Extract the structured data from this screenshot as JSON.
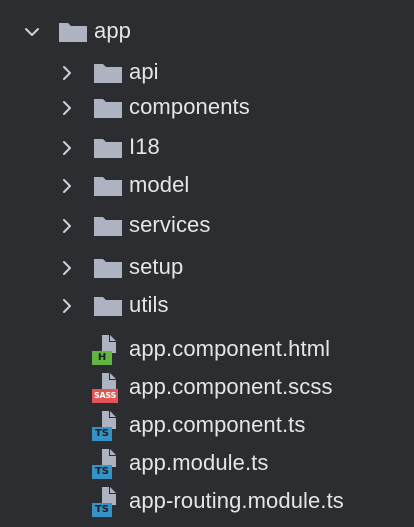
{
  "colors": {
    "background": "#2b2d30",
    "text": "#e3e5e8",
    "folder": "#aeb3c2",
    "chevron": "#ced0d6",
    "html_badge": "#62b543",
    "sass_badge": "#e05555",
    "ts_badge": "#3592c4"
  },
  "root": {
    "label": "app",
    "expanded": true,
    "icon": "folder-icon",
    "chevron": "chevron-down-icon"
  },
  "folders": [
    {
      "label": "api",
      "expanded": false,
      "icon": "folder-icon",
      "chevron": "chevron-right-icon"
    },
    {
      "label": "components",
      "expanded": false,
      "icon": "folder-icon",
      "chevron": "chevron-right-icon"
    },
    {
      "label": "I18",
      "expanded": false,
      "icon": "folder-icon",
      "chevron": "chevron-right-icon"
    },
    {
      "label": "model",
      "expanded": false,
      "icon": "folder-icon",
      "chevron": "chevron-right-icon"
    },
    {
      "label": "services",
      "expanded": false,
      "icon": "folder-icon",
      "chevron": "chevron-right-icon"
    },
    {
      "label": "setup",
      "expanded": false,
      "icon": "folder-icon",
      "chevron": "chevron-right-icon"
    },
    {
      "label": "utils",
      "expanded": false,
      "icon": "folder-icon",
      "chevron": "chevron-right-icon"
    }
  ],
  "files": [
    {
      "label": "app.component.html",
      "badge": "H",
      "icon": "html-file-icon"
    },
    {
      "label": "app.component.scss",
      "badge": "SASS",
      "icon": "sass-file-icon"
    },
    {
      "label": "app.component.ts",
      "badge": "TS",
      "icon": "typescript-file-icon"
    },
    {
      "label": "app.module.ts",
      "badge": "TS",
      "icon": "typescript-file-icon"
    },
    {
      "label": "app-routing.module.ts",
      "badge": "TS",
      "icon": "typescript-file-icon"
    }
  ]
}
